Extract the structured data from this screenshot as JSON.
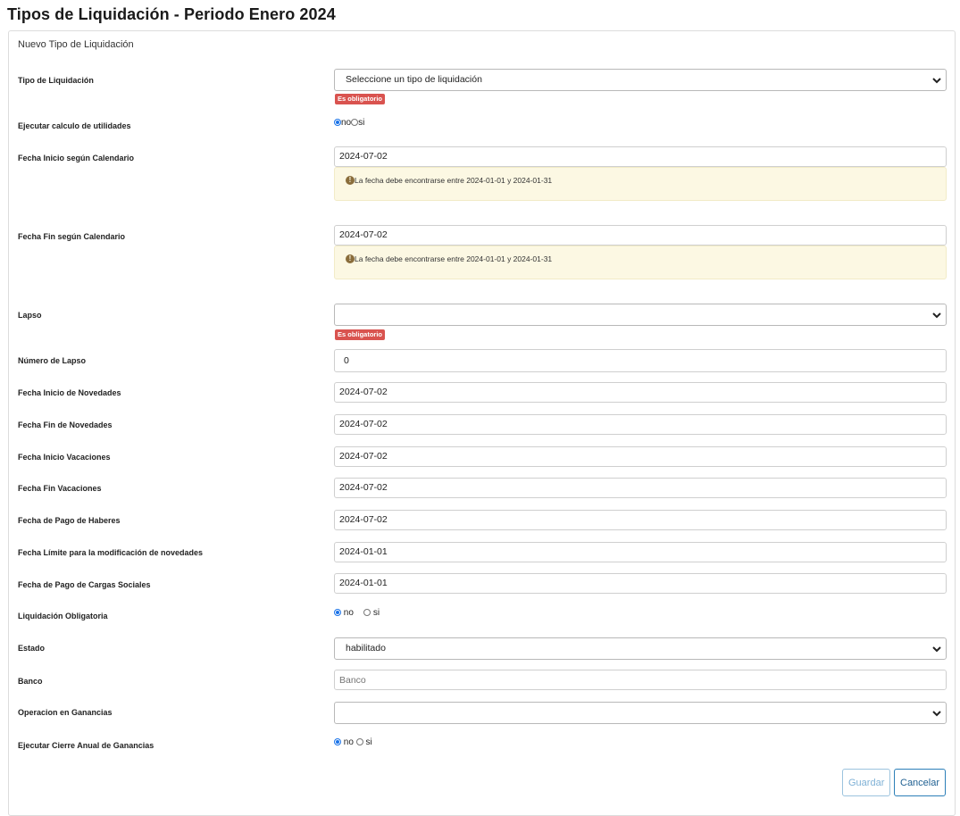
{
  "page": {
    "title": "Tipos de Liquidación - Periodo Enero 2024"
  },
  "panel": {
    "heading": "Nuevo Tipo de Liquidación"
  },
  "form": {
    "tipo_liquidacion": {
      "label": "Tipo de Liquidación",
      "value": "Seleccione un tipo de liquidación",
      "required_badge": "Es obligatorio"
    },
    "ejecutar_utilidades": {
      "label": "Ejecutar calculo de utilidades",
      "options": [
        "no",
        "si"
      ],
      "selected": "no"
    },
    "fecha_inicio_calendario": {
      "label": "Fecha Inicio según Calendario",
      "value": "2024-07-02",
      "warning": "La fecha debe encontrarse entre 2024-01-01 y 2024-01-31"
    },
    "fecha_fin_calendario": {
      "label": "Fecha Fin según Calendario",
      "value": "2024-07-02",
      "warning": "La fecha debe encontrarse entre 2024-01-01 y 2024-01-31"
    },
    "lapso": {
      "label": "Lapso",
      "value": "",
      "required_badge": "Es obligatorio"
    },
    "numero_lapso": {
      "label": "Número de Lapso",
      "value": "0"
    },
    "fecha_inicio_novedades": {
      "label": "Fecha Inicio de Novedades",
      "value": "2024-07-02"
    },
    "fecha_fin_novedades": {
      "label": "Fecha Fin de Novedades",
      "value": "2024-07-02"
    },
    "fecha_inicio_vacaciones": {
      "label": "Fecha Inicio Vacaciones",
      "value": "2024-07-02"
    },
    "fecha_fin_vacaciones": {
      "label": "Fecha Fin Vacaciones",
      "value": "2024-07-02"
    },
    "fecha_pago_haberes": {
      "label": "Fecha de Pago de Haberes",
      "value": "2024-07-02"
    },
    "fecha_limite_novedades": {
      "label": "Fecha Límite para la modificación de novedades",
      "value": "2024-01-01"
    },
    "fecha_pago_cargas": {
      "label": "Fecha de Pago de Cargas Sociales",
      "value": "2024-01-01"
    },
    "liquidacion_obligatoria": {
      "label": "Liquidación Obligatoria",
      "options": [
        "no",
        "si"
      ],
      "selected": "no"
    },
    "estado": {
      "label": "Estado",
      "value": "habilitado"
    },
    "banco": {
      "label": "Banco",
      "value": "",
      "placeholder": "Banco"
    },
    "operacion_ganancias": {
      "label": "Operacion en Ganancias",
      "value": ""
    },
    "cierre_anual_ganancias": {
      "label": "Ejecutar Cierre Anual de Ganancias",
      "options": [
        "no",
        "si"
      ],
      "selected": "no"
    }
  },
  "actions": {
    "save_label": "Guardar",
    "cancel_label": "Cancelar"
  },
  "icons": {
    "select_chevron": "chevron-down-icon",
    "alert": "exclamation-circle-icon"
  },
  "colors": {
    "badge": "#d9534f",
    "alert_bg": "#fcf8e3",
    "radio_checked": "#1a73e8",
    "button_border": "#2b7fb8"
  }
}
